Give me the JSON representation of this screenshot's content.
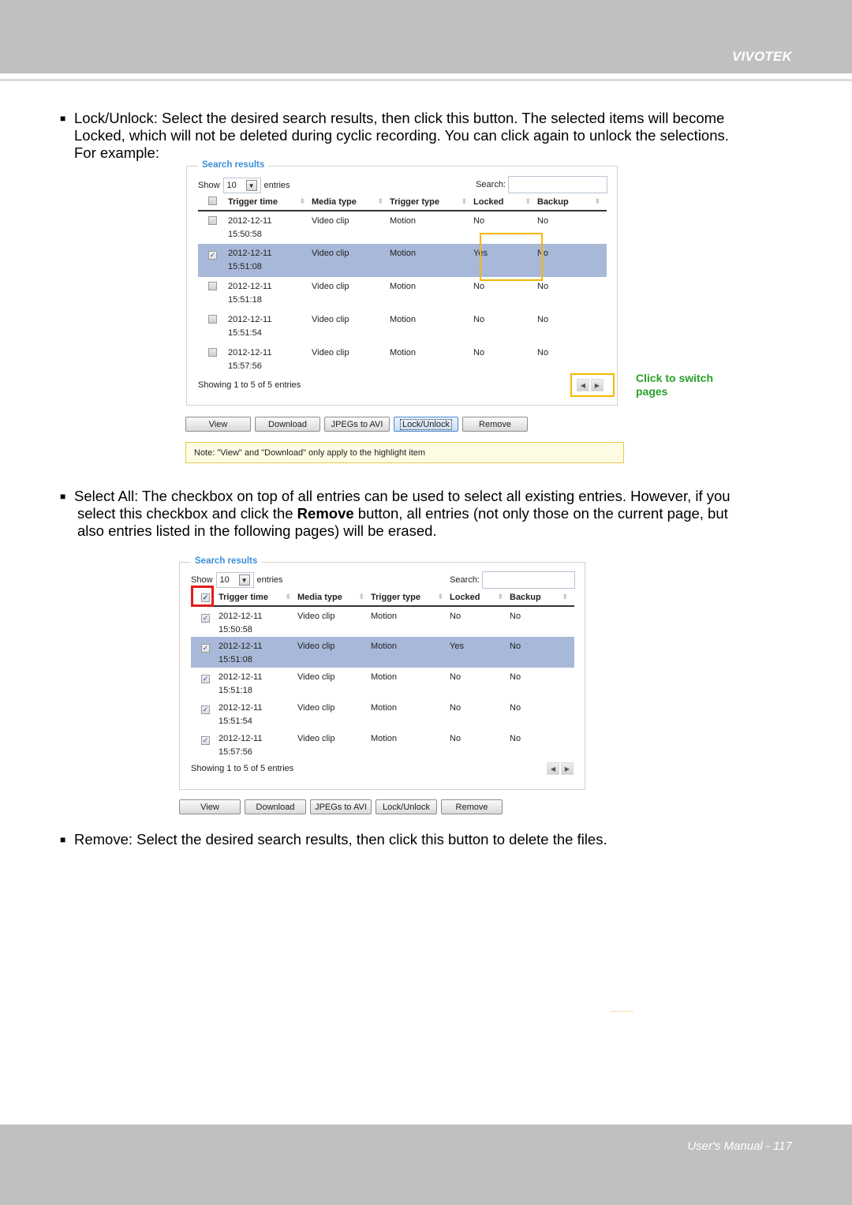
{
  "header": {
    "brand": "VIVOTEK"
  },
  "footer": {
    "page_label": "User's Manual - 117"
  },
  "paragraphs": {
    "lock_unlock": {
      "line1": "Lock/Unlock: Select the desired search results, then click this button. The selected items will become",
      "line2": "Locked, which will not be deleted during cyclic recording. You can click again to unlock the selections.",
      "line3": "For example:"
    },
    "select_all": {
      "line1": "Select All: The checkbox on top of all entries can be used to select all existing entries. However, if you",
      "line2_pre": "select this checkbox and click the ",
      "line2_bold": "Remove",
      "line2_post": " button, all entries (not only those on the current page, but",
      "line3": "also entries listed in the following pages) will be erased."
    },
    "remove": {
      "line1": "Remove: Select the desired search results, then click this button to delete the files."
    },
    "bullet": "■"
  },
  "panel1": {
    "legend": "Search results",
    "show_label": "Show",
    "show_value": "10",
    "entries_label": "entries",
    "search_label": "Search:",
    "search_value": "",
    "columns": [
      "Trigger time",
      "Media type",
      "Trigger type",
      "Locked",
      "Backup"
    ],
    "select_all_checked": false,
    "rows": [
      {
        "checked": false,
        "date": "2012-12-11",
        "time": "15:50:58",
        "media": "Video clip",
        "trigger": "Motion",
        "locked": "No",
        "backup": "No",
        "highlight": false
      },
      {
        "checked": true,
        "date": "2012-12-11",
        "time": "15:51:08",
        "media": "Video clip",
        "trigger": "Motion",
        "locked": "Yes",
        "backup": "No",
        "highlight": true
      },
      {
        "checked": false,
        "date": "2012-12-11",
        "time": "15:51:18",
        "media": "Video clip",
        "trigger": "Motion",
        "locked": "No",
        "backup": "No",
        "highlight": false
      },
      {
        "checked": false,
        "date": "2012-12-11",
        "time": "15:51:54",
        "media": "Video clip",
        "trigger": "Motion",
        "locked": "No",
        "backup": "No",
        "highlight": false
      },
      {
        "checked": false,
        "date": "2012-12-11",
        "time": "15:57:56",
        "media": "Video clip",
        "trigger": "Motion",
        "locked": "No",
        "backup": "No",
        "highlight": false
      }
    ],
    "showing": "Showing 1 to 5 of 5 entries",
    "buttons": [
      "View",
      "Download",
      "JPEGs to AVI",
      "Lock/Unlock",
      "Remove"
    ],
    "note": "Note: \"View\" and \"Download\" only apply to the highlight item",
    "annotation_line1": "Click to switch",
    "annotation_line2": "pages"
  },
  "panel2": {
    "legend": "Search results",
    "show_label": "Show",
    "show_value": "10",
    "entries_label": "entries",
    "search_label": "Search:",
    "search_value": "",
    "columns": [
      "Trigger time",
      "Media type",
      "Trigger type",
      "Locked",
      "Backup"
    ],
    "select_all_checked": true,
    "rows": [
      {
        "checked": true,
        "date": "2012-12-11",
        "time": "15:50:58",
        "media": "Video clip",
        "trigger": "Motion",
        "locked": "No",
        "backup": "No",
        "highlight": false
      },
      {
        "checked": true,
        "date": "2012-12-11",
        "time": "15:51:08",
        "media": "Video clip",
        "trigger": "Motion",
        "locked": "Yes",
        "backup": "No",
        "highlight": true
      },
      {
        "checked": true,
        "date": "2012-12-11",
        "time": "15:51:18",
        "media": "Video clip",
        "trigger": "Motion",
        "locked": "No",
        "backup": "No",
        "highlight": false
      },
      {
        "checked": true,
        "date": "2012-12-11",
        "time": "15:51:54",
        "media": "Video clip",
        "trigger": "Motion",
        "locked": "No",
        "backup": "No",
        "highlight": false
      },
      {
        "checked": true,
        "date": "2012-12-11",
        "time": "15:57:56",
        "media": "Video clip",
        "trigger": "Motion",
        "locked": "No",
        "backup": "No",
        "highlight": false
      }
    ],
    "showing": "Showing 1 to 5 of 5 entries",
    "buttons": [
      "View",
      "Download",
      "JPEGs to AVI",
      "Lock/Unlock",
      "Remove"
    ]
  },
  "icons": {
    "checkmark": "✓",
    "dropdown": "▼",
    "sort": "⬍",
    "prev": "◀",
    "next": "▶"
  }
}
